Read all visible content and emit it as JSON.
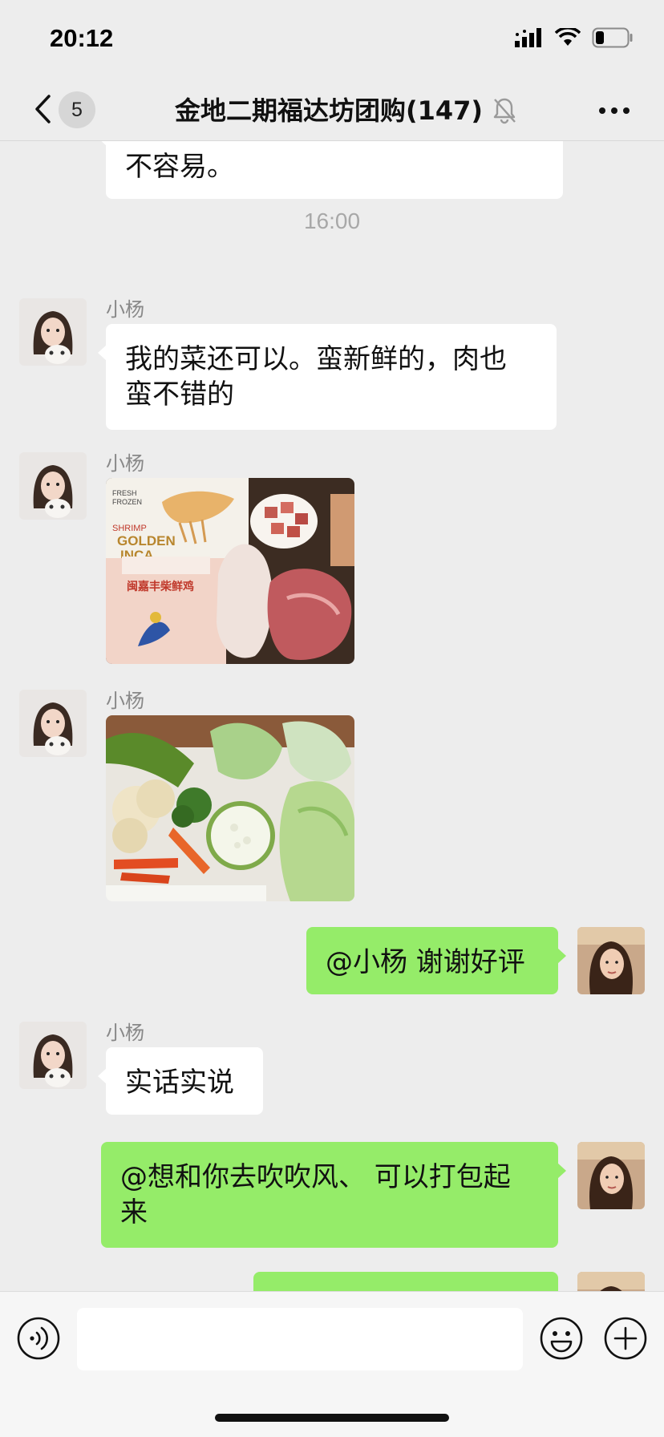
{
  "status_bar": {
    "time": "20:12"
  },
  "nav": {
    "unread_count": "5",
    "title": "金地二期福达坊团购(147)"
  },
  "messages": {
    "m0": {
      "text": "不容易。"
    },
    "time_1": "16:00",
    "m1": {
      "sender": "小杨",
      "text_line1": "我的菜还可以。蛮新鲜的，肉也",
      "text_line2": "蛮不错的"
    },
    "m2": {
      "sender": "小杨",
      "photo": {
        "label_fresh": "FRESH",
        "label_frozen": "FROZEN",
        "label_shrimp": "SHRIMP",
        "label_golden": "GOLDEN",
        "label_inca": "INCA",
        "label_bag": "闽嘉丰柴鲜鸡"
      }
    },
    "m3": {
      "sender": "小杨"
    },
    "m4": {
      "text": "@小杨 谢谢好评"
    },
    "m5": {
      "sender": "小杨",
      "text": "实话实说"
    },
    "m6": {
      "text_line1": "@想和你去吹吹风、 可以打包起",
      "text_line2": "来"
    }
  },
  "input_bar": {
    "placeholder": ""
  },
  "colors": {
    "background": "#ededed",
    "bubble_incoming": "#ffffff",
    "bubble_outgoing": "#95ec69"
  },
  "icons": [
    "chevron-left-icon",
    "mute-bell-icon",
    "more-icon",
    "voice-icon",
    "emoji-icon",
    "plus-icon",
    "signal-icon",
    "wifi-icon",
    "battery-icon"
  ]
}
